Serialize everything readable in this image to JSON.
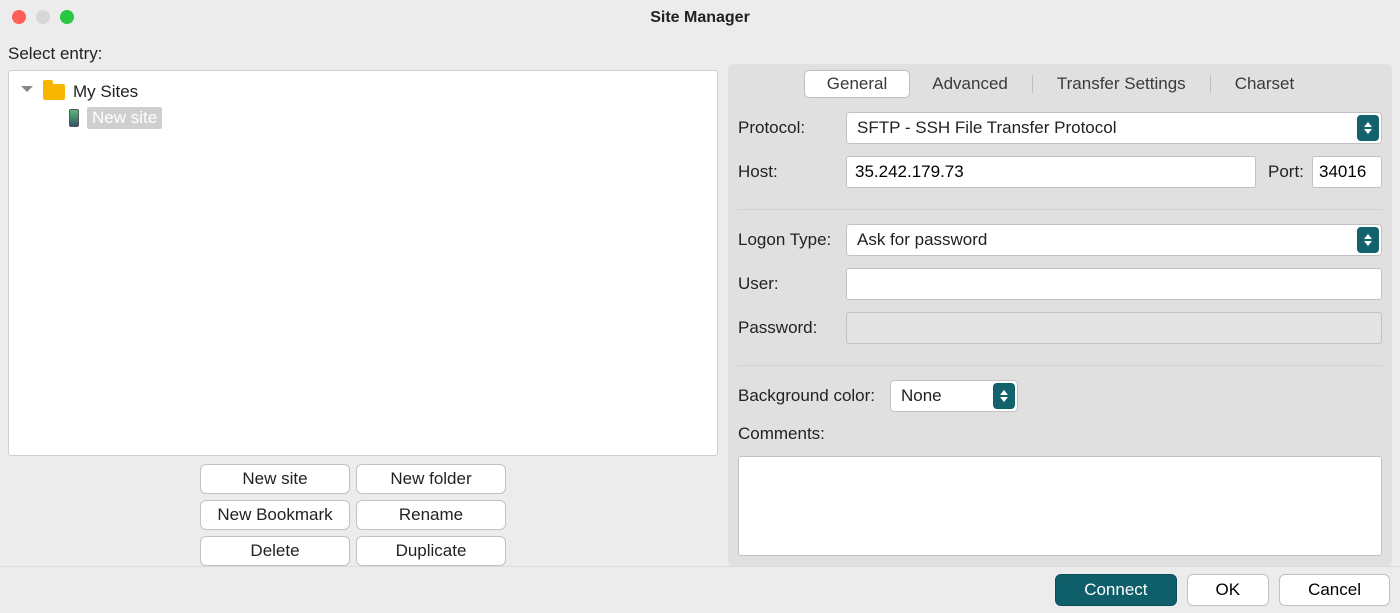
{
  "window": {
    "title": "Site Manager"
  },
  "left_panel": {
    "label": "Select entry:",
    "root_name": "My Sites",
    "entry_name": "New site",
    "buttons": {
      "new_site": "New site",
      "new_folder": "New folder",
      "new_bookmark": "New Bookmark",
      "rename": "Rename",
      "delete": "Delete",
      "duplicate": "Duplicate"
    }
  },
  "tabs": {
    "general": "General",
    "advanced": "Advanced",
    "transfer": "Transfer Settings",
    "charset": "Charset"
  },
  "form": {
    "protocol_label": "Protocol:",
    "protocol_value": "SFTP - SSH File Transfer Protocol",
    "host_label": "Host:",
    "host_value": "35.242.179.73",
    "port_label": "Port:",
    "port_value": "34016",
    "logon_label": "Logon Type:",
    "logon_value": "Ask for password",
    "user_label": "User:",
    "user_value": "",
    "password_label": "Password:",
    "password_value": "",
    "bgcolor_label": "Background color:",
    "bgcolor_value": "None",
    "comments_label": "Comments:",
    "comments_value": ""
  },
  "footer": {
    "connect": "Connect",
    "ok": "OK",
    "cancel": "Cancel"
  }
}
